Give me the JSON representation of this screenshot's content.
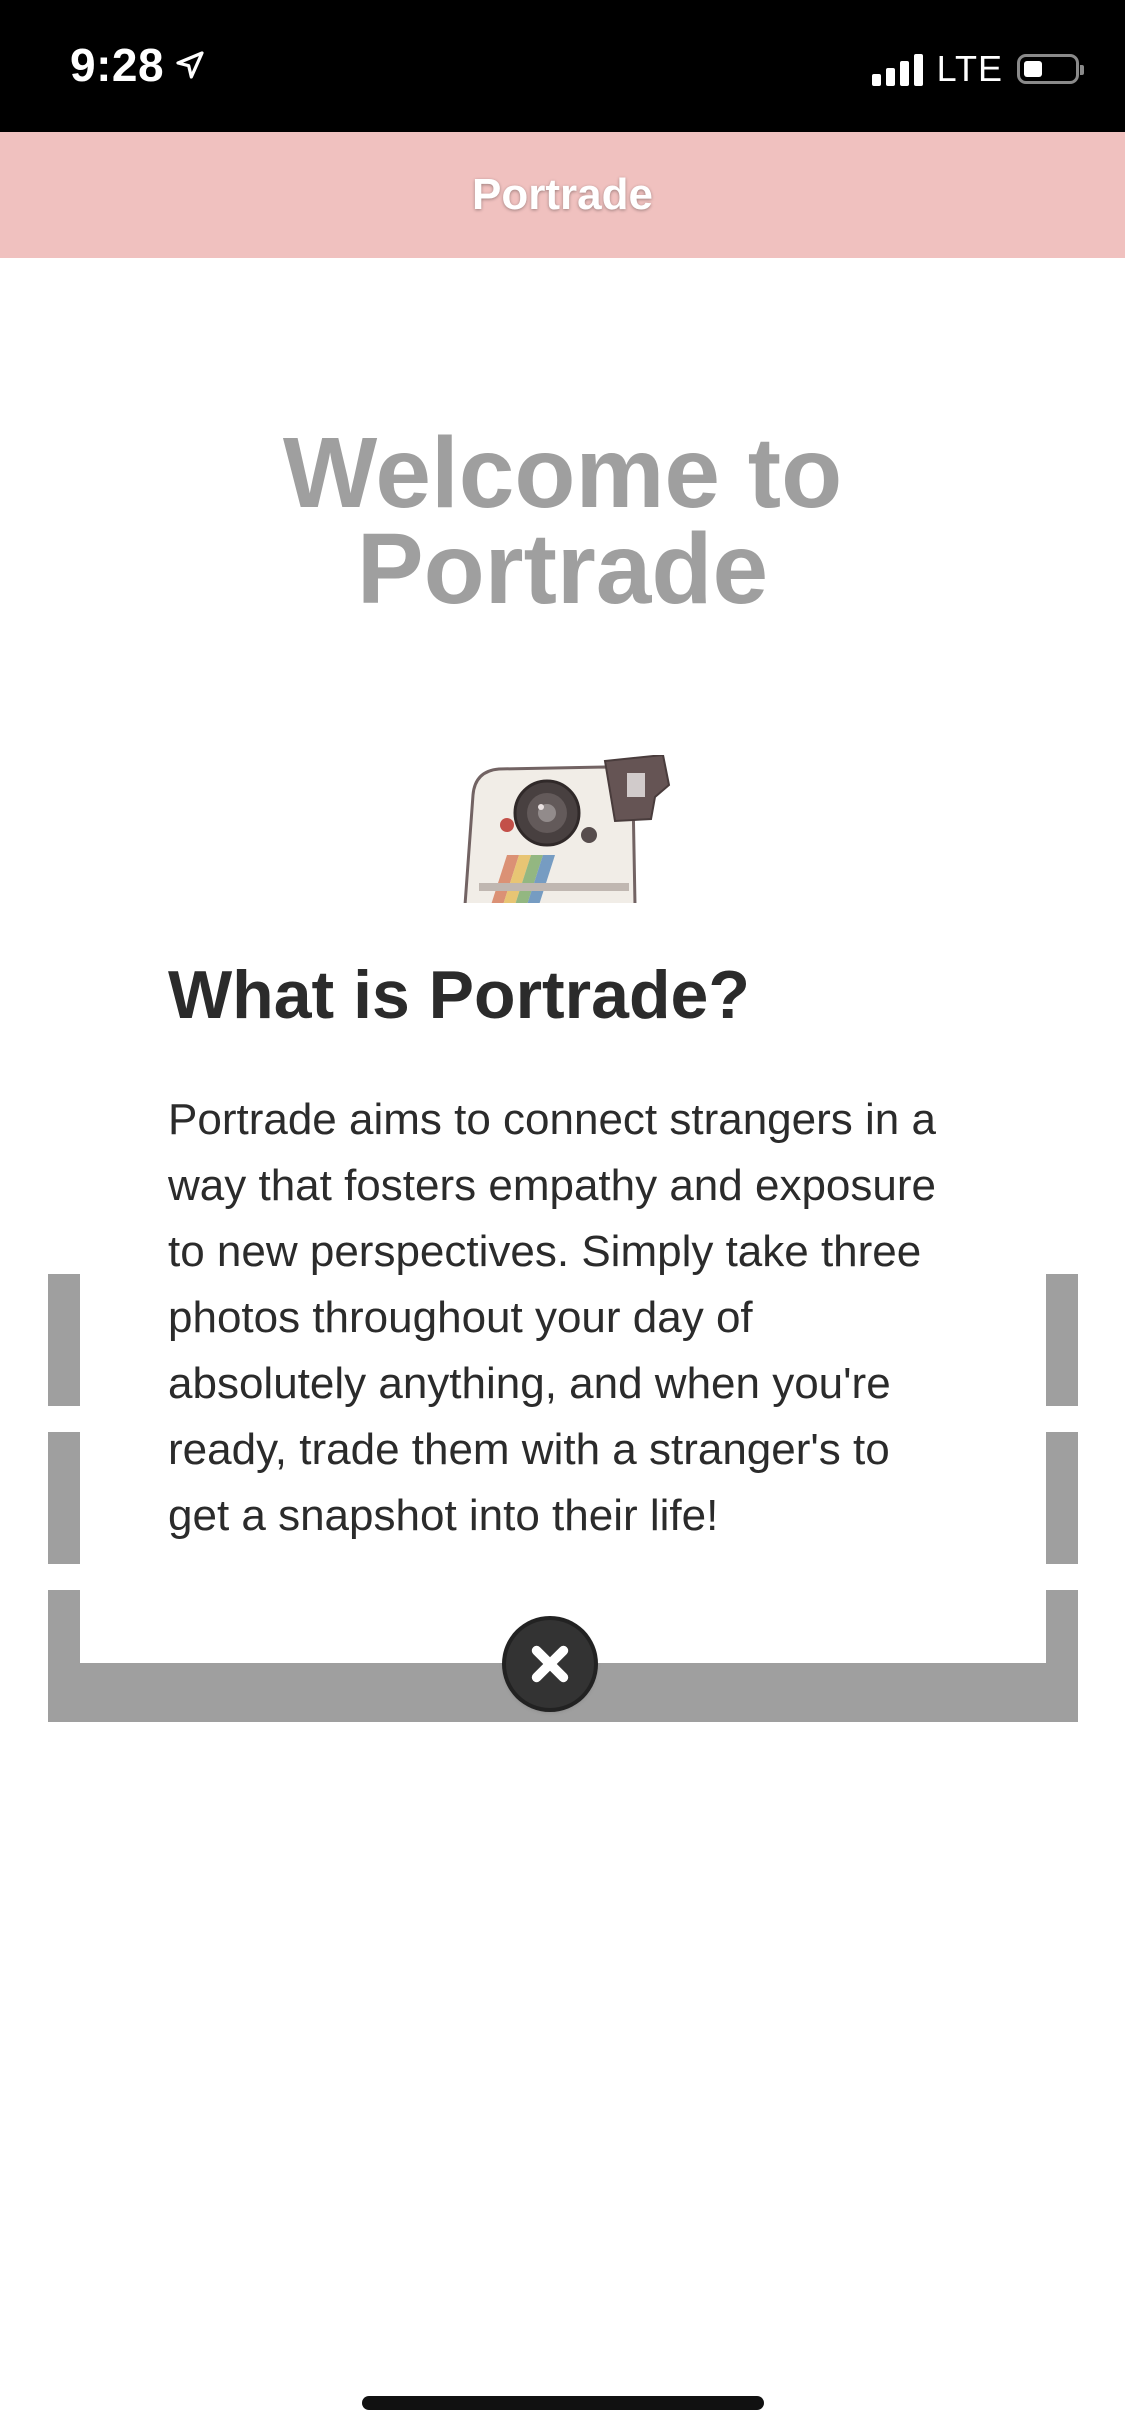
{
  "status_bar": {
    "time": "9:28",
    "network": "LTE",
    "icons": [
      "location-arrow-icon",
      "signal-icon",
      "battery-icon"
    ]
  },
  "header": {
    "title": "Portrade",
    "background_color": "#f0c1bf"
  },
  "welcome": {
    "line1": "Welcome to",
    "line2": "Portrade",
    "image": "instant-camera-illustration"
  },
  "modal": {
    "title": "What is Portrade?",
    "body": "Portrade aims to connect strangers in a way that fosters empathy and exposure to new perspectives. Simply take three photos throughout your day of absolutely anything, and when you're ready, trade them with a stranger's to get a snapshot into their life!",
    "close_icon": "close-icon"
  },
  "colors": {
    "accent": "#f0c1bf",
    "button_gray": "#999999",
    "text_dark": "#2b2b2b",
    "close_button": "#333333"
  }
}
